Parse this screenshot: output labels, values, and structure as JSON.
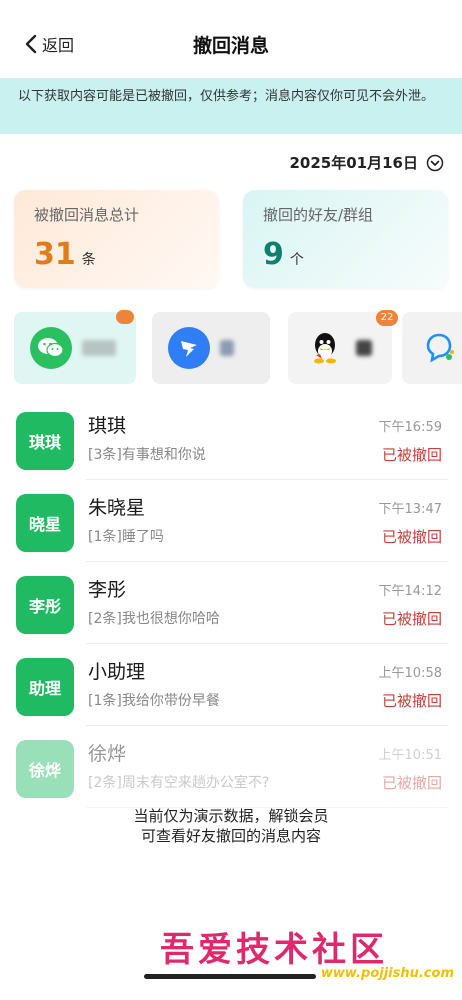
{
  "header": {
    "back_label": "返回",
    "title": "撤回消息"
  },
  "notice": "以下获取内容可能是已被撤回，仅供参考；消息内容仅你可见不会外泄。",
  "date": "2025年01月16日",
  "stats": {
    "total_label": "被撤回消息总计",
    "total_value": "31",
    "total_unit": "条",
    "friends_label": "撤回的好友/群组",
    "friends_value": "9",
    "friends_unit": "个"
  },
  "apps": [
    {
      "icon": "wechat-icon",
      "badge": ""
    },
    {
      "icon": "dingtalk-icon",
      "badge": ""
    },
    {
      "icon": "qq-icon",
      "badge": "22"
    },
    {
      "icon": "chat-bubble-icon",
      "badge": ""
    }
  ],
  "messages": [
    {
      "avatar": "琪琪",
      "name": "琪琪",
      "preview": "[3条]有事想和你说",
      "time": "下午16:59",
      "status": "已被撤回"
    },
    {
      "avatar": "晓星",
      "name": "朱晓星",
      "preview": "[1条]睡了吗",
      "time": "下午13:47",
      "status": "已被撤回"
    },
    {
      "avatar": "李彤",
      "name": "李彤",
      "preview": "[2条]我也很想你哈哈",
      "time": "下午14:12",
      "status": "已被撤回"
    },
    {
      "avatar": "助理",
      "name": "小助理",
      "preview": "[1条]我给你带份早餐",
      "time": "上午10:58",
      "status": "已被撤回"
    },
    {
      "avatar": "徐烨",
      "name": "徐烨",
      "preview": "[2条]周末有空来趟办公室不?",
      "time": "上午10:51",
      "status": "已被撤回"
    }
  ],
  "demo_notice": {
    "line1": "当前仅为演示数据，解锁会员",
    "line2": "可查看好友撤回的消息内容"
  },
  "watermark": {
    "text": "吾爱技术社区",
    "url": "www.pojjishu.com"
  },
  "colors": {
    "notice_bg": "#c9f1ef",
    "accent_green": "#1fba62",
    "status_red": "#c8403a",
    "total_orange": "#e07d1a",
    "friends_teal": "#10806e"
  }
}
